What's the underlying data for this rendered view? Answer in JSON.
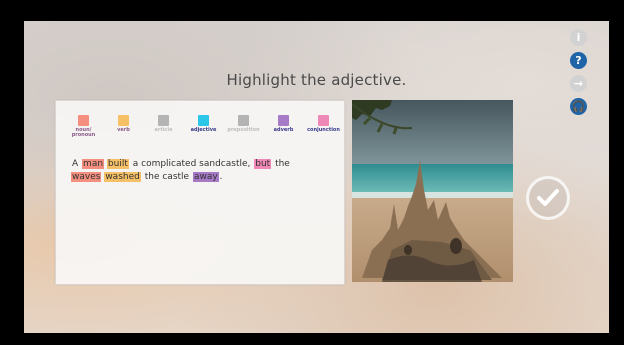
{
  "title": "Highlight the adjective.",
  "legend": [
    {
      "label": "noun/\npronoun",
      "color": "#f48f7f",
      "label_color": "#8a5a8a"
    },
    {
      "label": "verb",
      "color": "#f6c067",
      "label_color": "#8a5a8a"
    },
    {
      "label": "article",
      "color": "#b4b4b4",
      "label_color": "#bdbdbd"
    },
    {
      "label": "adjective",
      "color": "#2cc6e8",
      "label_color": "#3a3a8a"
    },
    {
      "label": "preposition",
      "color": "#b4b4b4",
      "label_color": "#bdbdbd"
    },
    {
      "label": "adverb",
      "color": "#a77ac8",
      "label_color": "#3a3a8a"
    },
    {
      "label": "conjunction",
      "color": "#ef88b6",
      "label_color": "#3a3a8a"
    }
  ],
  "sentence": {
    "line1": [
      {
        "text": "A",
        "hl": null
      },
      {
        "text": "man",
        "hl": "#f48f7f"
      },
      {
        "text": "built",
        "hl": "#f6c067"
      },
      {
        "text": "a complicated sandcastle,",
        "hl": null
      },
      {
        "text": "but",
        "hl": "#ef88b6"
      },
      {
        "text": "the",
        "hl": null
      }
    ],
    "line2": [
      {
        "text": "waves",
        "hl": "#f48f7f"
      },
      {
        "text": "washed",
        "hl": "#f6c067"
      },
      {
        "text": "the castle",
        "hl": null
      },
      {
        "text": "away",
        "hl": "#a77ac8"
      },
      {
        "text": ".",
        "hl": null
      }
    ]
  },
  "side_buttons": [
    {
      "name": "info-icon",
      "color": "#d2d2d2",
      "glyph": "i"
    },
    {
      "name": "help-icon",
      "color": "#1f64a7",
      "glyph": "?"
    },
    {
      "name": "forward-icon",
      "color": "#d2d2d2",
      "glyph": "→"
    },
    {
      "name": "headphones-icon",
      "color": "#1f64a7",
      "glyph": "🎧"
    }
  ],
  "check_button": {
    "glyph": "✓"
  }
}
